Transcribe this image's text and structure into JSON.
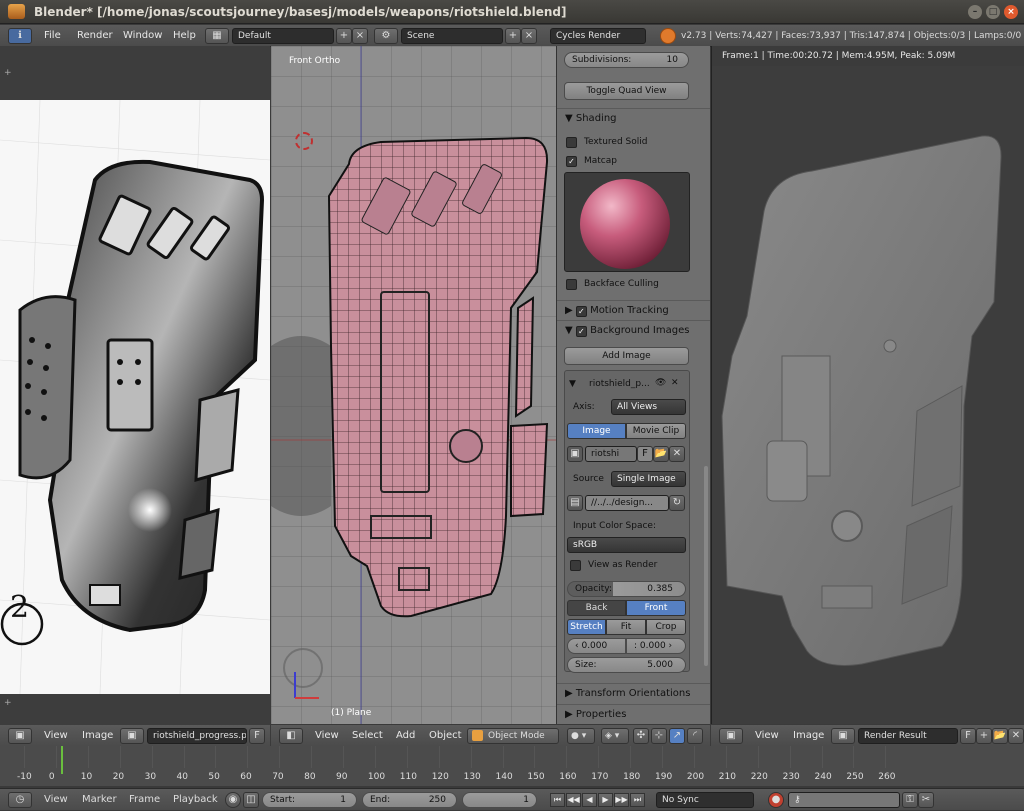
{
  "window": {
    "title": "Blender* [/home/jonas/scoutsjourney/basesj/models/weapons/riotshield.blend]",
    "minimize": "–",
    "maximize": "□",
    "close": "×"
  },
  "info_header": {
    "menus": [
      "File",
      "Render",
      "Window",
      "Help"
    ],
    "layout": "Default",
    "scene": "Scene",
    "engine": "Cycles Render",
    "stats": "v2.73 | Verts:74,427 | Faces:73,937 | Tris:147,874 | Objects:0/3 | Lamps:0/0 |"
  },
  "image_editor_left": {
    "menus": [
      "View",
      "Image"
    ],
    "image_name": "riotshield_progress.png",
    "fake_user": "F",
    "sketch_number": "2"
  },
  "viewport": {
    "label": "Front Ortho",
    "object_label": "(1) Plane",
    "menus": [
      "View",
      "Select",
      "Add",
      "Object"
    ],
    "mode": "Object Mode"
  },
  "properties": {
    "top_field_label": "Subdivisions:",
    "top_field_value": "10",
    "toggle_quad_view": "Toggle Quad View",
    "shading_header": "Shading",
    "textured_solid": "Textured Solid",
    "matcap": "Matcap",
    "backface_culling": "Backface Culling",
    "motion_tracking": "Motion Tracking",
    "background_images": "Background Images",
    "add_image": "Add Image",
    "bg_image_name": "riotshield_p...",
    "axis_label": "Axis:",
    "axis_value": "All Views",
    "type_image": "Image",
    "type_movie_clip": "Movie Clip",
    "image_block": "riotshi",
    "fake_user": "F",
    "source_label": "Source",
    "source_value": "Single Image",
    "filepath": "//../../design...",
    "input_color_space_label": "Input Color Space:",
    "color_space": "sRGB",
    "view_as_render": "View as Render",
    "opacity_label": "Opacity:",
    "opacity_value": "0.385",
    "opacity": 0.385,
    "back": "Back",
    "front": "Front",
    "stretch": "Stretch",
    "fit": "Fit",
    "crop": "Crop",
    "offset_x": "0.000",
    "offset_y": "0.000",
    "size_label": "Size:",
    "size_value": "5.000",
    "transform_orientations": "Transform Orientations",
    "properties_panel": "Properties"
  },
  "render_view": {
    "info": "Frame:1 | Time:00:20.72 | Mem:4.95M, Peak: 5.09M",
    "menus": [
      "View",
      "Image"
    ],
    "image_name": "Render Result",
    "fake_user": "F"
  },
  "timeline": {
    "ticks": [
      "-10",
      "0",
      "10",
      "20",
      "30",
      "40",
      "50",
      "60",
      "70",
      "80",
      "90",
      "100",
      "110",
      "120",
      "130",
      "140",
      "150",
      "160",
      "170",
      "180",
      "190",
      "200",
      "210",
      "220",
      "230",
      "240",
      "250",
      "260"
    ],
    "menus": [
      "View",
      "Marker",
      "Frame",
      "Playback"
    ],
    "start_label": "Start:",
    "start_value": "1",
    "end_label": "End:",
    "end_value": "250",
    "current_frame": "1",
    "sync": "No Sync"
  },
  "colors": {
    "accent_blue": "#5680c2",
    "mesh_pink": "#c98f9c",
    "frame_green": "#6abf3e"
  }
}
